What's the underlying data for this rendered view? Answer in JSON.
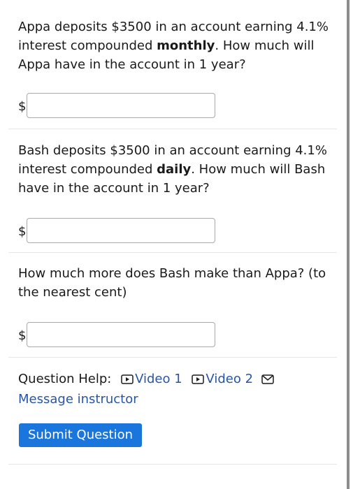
{
  "questions": [
    {
      "text_before": "Appa deposits $3500 in an account earning 4.1% interest compounded ",
      "emphasis": "monthly",
      "text_after": ". How much will Appa have in the account in 1 year?",
      "currency": "$",
      "value": ""
    },
    {
      "text_before": "Bash deposits $3500 in an account earning 4.1% interest compounded ",
      "emphasis": "daily",
      "text_after": ". How much will Bash have in the account in 1 year?",
      "currency": "$",
      "value": ""
    },
    {
      "text": "How much more does Bash make than Appa? (to the nearest cent)",
      "currency": "$",
      "value": ""
    }
  ],
  "help": {
    "label": "Question Help:",
    "video1": "Video 1",
    "video2": "Video 2",
    "message": "Message instructor"
  },
  "submit_label": "Submit Question",
  "colors": {
    "link": "#2855a6",
    "button": "#1a75dc",
    "input_border": "#a9a9a9"
  }
}
